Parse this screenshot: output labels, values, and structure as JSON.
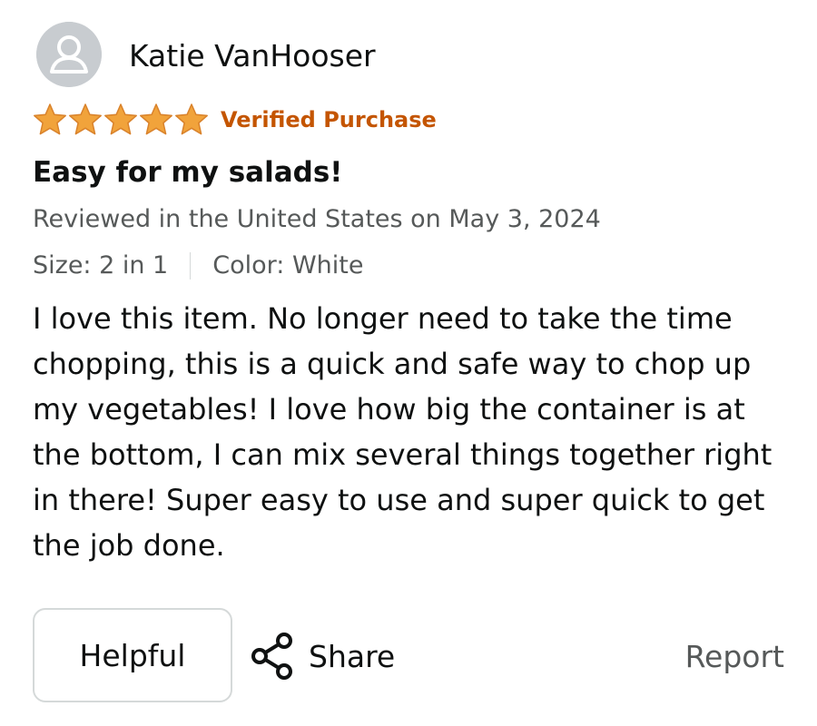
{
  "reviewer": {
    "name": "Katie VanHooser",
    "avatar_icon": "person-silhouette-icon"
  },
  "rating": {
    "stars": 5,
    "max_stars": 5,
    "star_icon": "star-icon",
    "star_color": "#f1a33b",
    "star_outline": "#d9822b"
  },
  "badge": {
    "label": "Verified Purchase",
    "color": "#c45500"
  },
  "review": {
    "title": "Easy for my salads!",
    "date_line": "Reviewed in the United States on May 3, 2024",
    "size": "Size: 2 in 1",
    "color": "Color: White",
    "body": "I love this item. No longer need to take the time chopping, this is a quick and safe way to chop up my vegetables! I love how big the container is at the bottom, I can mix several things together right in there! Super easy to use and super quick to get the job done."
  },
  "actions": {
    "helpful_label": "Helpful",
    "share_label": "Share",
    "share_icon": "share-icon",
    "report_label": "Report"
  }
}
